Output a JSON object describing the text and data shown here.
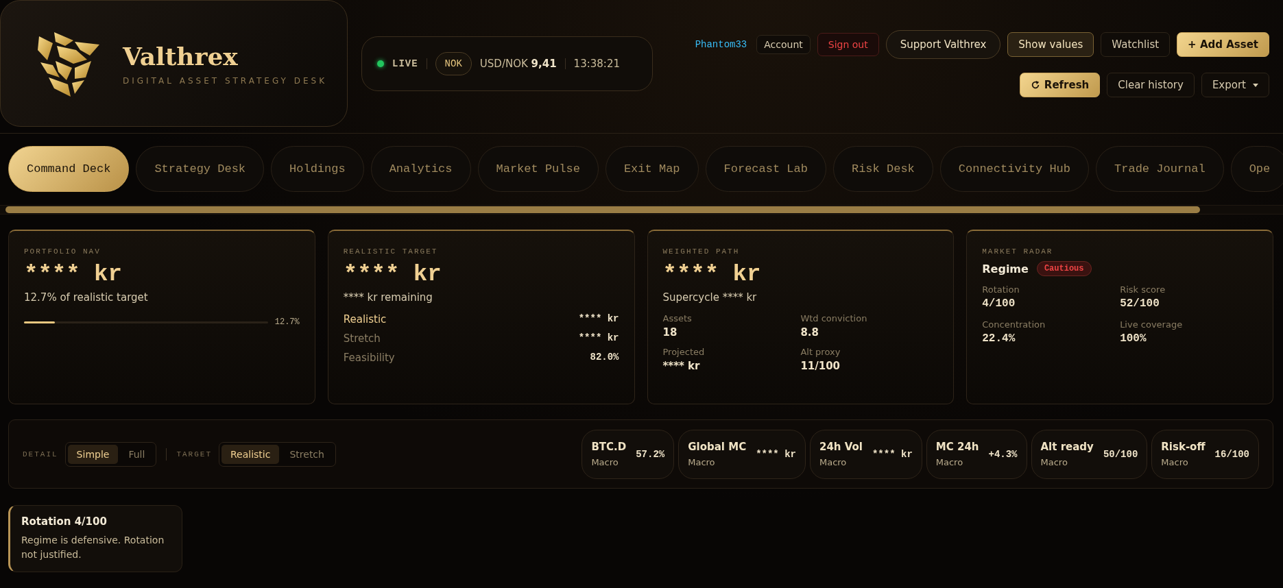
{
  "brand": {
    "name": "Valthrex",
    "tagline": "DIGITAL ASSET STRATEGY DESK"
  },
  "status": {
    "live": true,
    "live_label": "LIVE",
    "currency": "NOK",
    "rate_label": "USD/NOK",
    "rate": "9,41",
    "time": "13:38:21"
  },
  "user": {
    "name": "Phantom33"
  },
  "actions_top": [
    {
      "label": "Account",
      "kind": "plain"
    },
    {
      "label": "Sign out",
      "kind": "danger"
    },
    {
      "label": "Support Valthrex",
      "kind": "pill"
    },
    {
      "label": "Show values",
      "kind": "outlined"
    },
    {
      "label": "Watchlist",
      "kind": "plain"
    },
    {
      "label": "+ Add Asset",
      "kind": "gold"
    }
  ],
  "actions_bottom": [
    {
      "label": "Refresh",
      "kind": "refresh"
    },
    {
      "label": "Clear history",
      "kind": "plain"
    },
    {
      "label": "Export",
      "kind": "menu"
    }
  ],
  "tabs": [
    {
      "label": "Command Deck",
      "selected": true
    },
    {
      "label": "Strategy Desk",
      "selected": false
    },
    {
      "label": "Holdings",
      "selected": false
    },
    {
      "label": "Analytics",
      "selected": false
    },
    {
      "label": "Market Pulse",
      "selected": false
    },
    {
      "label": "Exit Map",
      "selected": false
    },
    {
      "label": "Forecast Lab",
      "selected": false
    },
    {
      "label": "Risk Desk",
      "selected": false
    },
    {
      "label": "Connectivity Hub",
      "selected": false
    },
    {
      "label": "Trade Journal",
      "selected": false
    },
    {
      "label": "Ope",
      "selected": false
    }
  ],
  "cards": [
    {
      "kind": "progress",
      "label": "PORTFOLIO NAV",
      "value": "**** kr",
      "sub": "12.7% of realistic target",
      "level": 0.127,
      "reading": "12.7%"
    },
    {
      "kind": "list",
      "label": "REALISTIC TARGET",
      "value": "**** kr",
      "sub": "**** kr remaining",
      "rows": [
        {
          "name": "Realistic",
          "value": "**** kr",
          "highlighted": true
        },
        {
          "name": "Stretch",
          "value": "**** kr",
          "highlighted": false
        },
        {
          "name": "Feasibility",
          "value": "82.0%",
          "highlighted": false
        }
      ]
    },
    {
      "kind": "grid",
      "label": "WEIGHTED PATH",
      "value": "**** kr",
      "sub": "Supercycle **** kr",
      "stats": [
        {
          "name": "Assets",
          "value": "18"
        },
        {
          "name": "Wtd conviction",
          "value": "8.8"
        },
        {
          "name": "Projected",
          "value": "**** kr"
        },
        {
          "name": "Alt proxy",
          "value": "11/100"
        }
      ]
    },
    {
      "kind": "radar",
      "label": "MARKET RADAR",
      "regime_label": "Regime",
      "regime": "Cautious",
      "stats": [
        {
          "name": "Rotation",
          "value": "4/100"
        },
        {
          "name": "Risk score",
          "value": "52/100"
        },
        {
          "name": "Concentration",
          "value": "22.4%"
        },
        {
          "name": "Live coverage",
          "value": "100%"
        }
      ]
    }
  ],
  "detail": {
    "label": "DETAIL",
    "options": [
      {
        "label": "Simple",
        "selected": true
      },
      {
        "label": "Full",
        "selected": false
      }
    ]
  },
  "target": {
    "label": "TARGET",
    "options": [
      {
        "label": "Realistic",
        "selected": true
      },
      {
        "label": "Stretch",
        "selected": false
      }
    ]
  },
  "metrics": [
    {
      "name": "BTC.D",
      "sub": "Macro",
      "value": "57.2%"
    },
    {
      "name": "Global MC",
      "sub": "Macro",
      "value": "**** kr"
    },
    {
      "name": "24h Vol",
      "sub": "Macro",
      "value": "**** kr"
    },
    {
      "name": "MC 24h",
      "sub": "Macro",
      "value": "+4.3%"
    },
    {
      "name": "Alt ready",
      "sub": "Macro",
      "value": "50/100"
    },
    {
      "name": "Risk-off",
      "sub": "Macro",
      "value": "16/100"
    }
  ],
  "note": {
    "title": "Rotation 4/100",
    "text": "Regime is defensive. Rotation not justified."
  }
}
